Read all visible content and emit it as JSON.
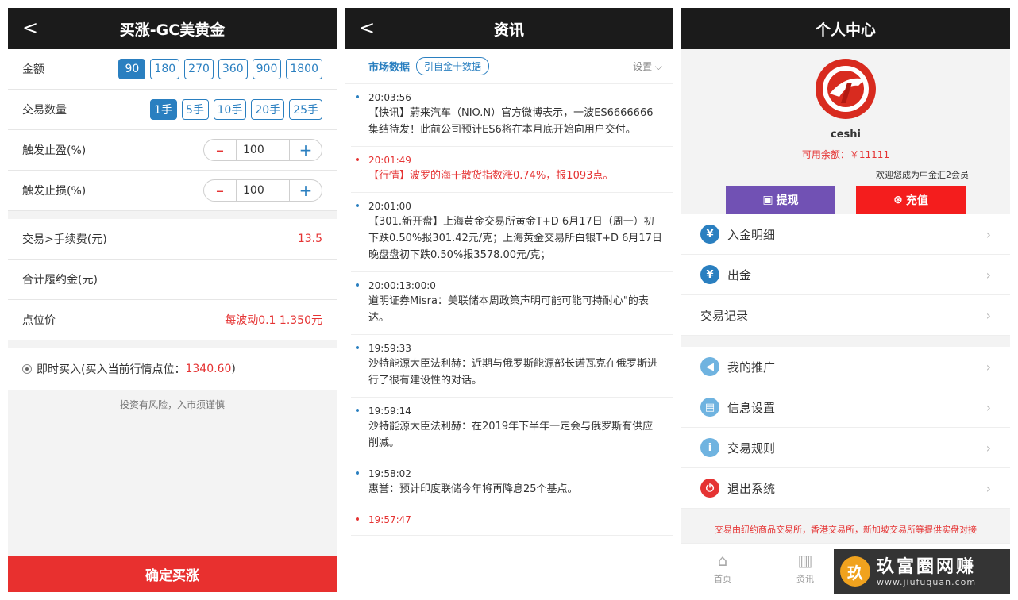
{
  "panel1": {
    "title": "买涨-GC美黄金",
    "back": "<",
    "amount_label": "金额",
    "amounts": [
      "90",
      "180",
      "270",
      "360",
      "900",
      "1800"
    ],
    "qty_label": "交易数量",
    "qtys": [
      "1手",
      "5手",
      "10手",
      "20手",
      "25手"
    ],
    "tp_label": "触发止盈(%)",
    "tp_value": "100",
    "sl_label": "触发止损(%)",
    "sl_value": "100",
    "minus": "–",
    "plus": "+",
    "fee_label": "交易>手续费(元)",
    "fee_value": "13.5",
    "margin_label": "合计履约金(元)",
    "point_label": "点位价",
    "point_value": "每波动0.1        1.350元",
    "buy_text": "即时买入(买入当前行情点位：",
    "buy_price": "1340.60",
    "buy_close": ")",
    "notice": "投资有风险，入市须谨慎",
    "confirm": "确定买涨"
  },
  "panel2": {
    "title": "资讯",
    "back": "<",
    "market": "市场数据",
    "tag": "引自金十数据",
    "settings": "设置 ⌵",
    "news": [
      {
        "time": "20:03:56",
        "text": "【快讯】蔚来汽车（NIO.N）官方微博表示，一波ES6666666集结待发！此前公司预计ES6将在本月底开始向用户交付。",
        "red": false
      },
      {
        "time": "20:01:49",
        "text": "【行情】波罗的海干散货指数涨0.74%，报1093点。",
        "red": true
      },
      {
        "time": "20:01:00",
        "text": "【301.新开盘】上海黄金交易所黄金T+D 6月17日（周一）初下跌0.50%报301.42元/克；上海黄金交易所白银T+D 6月17日 晚盘盘初下跌0.50%报3578.00元/克；",
        "red": false
      },
      {
        "time": "20:00:13:00:0",
        "text": "道明证券Misra：美联储本周政策声明可能可能可持耐心\"的表达。",
        "red": false
      },
      {
        "time": "19:59:33",
        "text": "沙特能源大臣法利赫：近期与俄罗斯能源部长诺瓦克在俄罗斯进行了很有建设性的对话。",
        "red": false
      },
      {
        "time": "19:59:14",
        "text": "沙特能源大臣法利赫：在2019年下半年一定会与俄罗斯有供应削减。",
        "red": false
      },
      {
        "time": "19:58:02",
        "text": "惠誉：预计印度联储今年将再降息25个基点。",
        "red": false
      },
      {
        "time": "19:57:47",
        "text": "",
        "red": true
      }
    ]
  },
  "panel3": {
    "title": "个人中心",
    "username": "ceshi",
    "balance": "可用余额：￥11111",
    "welcome": "欢迎您成为中金汇2会员",
    "withdraw": "提现",
    "recharge": "充值",
    "menu_group1": [
      "入金明细",
      "出金",
      "交易记录"
    ],
    "menu_group2": [
      "我的推广",
      "信息设置",
      "交易规则",
      "退出系统"
    ],
    "footer": "交易由纽约商品交易所，香港交易所，新加坡交易所等提供实盘对接",
    "tabs": [
      "首页",
      "资讯"
    ]
  },
  "watermark": {
    "logo": "玖",
    "cn": "玖富圈网赚",
    "url": "www.jiufuquan.com"
  },
  "colors": {
    "header": "#1b1b1b",
    "accent_blue": "#2a7fc0",
    "accent_red": "#e8302f",
    "purple": "#7151b4"
  }
}
